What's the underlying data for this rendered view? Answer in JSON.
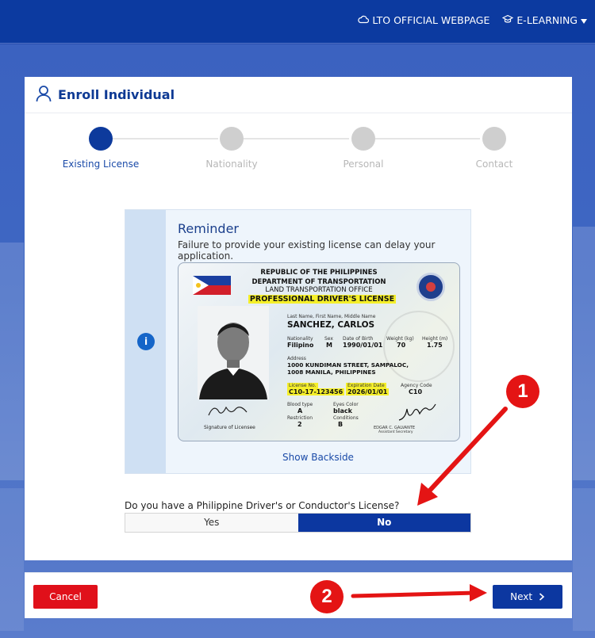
{
  "header": {
    "links": [
      {
        "label": "LTO OFFICIAL WEBPAGE",
        "icon": "cloud-icon"
      },
      {
        "label": "E-LEARNING",
        "icon": "graduation-cap-icon",
        "dropdown": true
      }
    ]
  },
  "card": {
    "title": "Enroll Individual",
    "title_icon": "user-icon"
  },
  "stepper": {
    "steps": [
      {
        "label": "Existing License",
        "active": true
      },
      {
        "label": "Nationality",
        "active": false
      },
      {
        "label": "Personal",
        "active": false
      },
      {
        "label": "Contact",
        "active": false
      }
    ]
  },
  "reminder": {
    "icon": "info-icon",
    "info_glyph": "i",
    "title": "Reminder",
    "text": "Failure to provide your existing license can delay your application.",
    "show_backside": "Show Backside"
  },
  "license_card": {
    "line1": "REPUBLIC OF THE PHILIPPINES",
    "line2": "DEPARTMENT OF TRANSPORTATION",
    "line3": "LAND TRANSPORTATION OFFICE",
    "line4": "PROFESSIONAL DRIVER'S LICENSE",
    "name_label": "Last Name, First Name, Middle Name",
    "name": "SANCHEZ, CARLOS",
    "nationality_label": "Nationality",
    "nationality": "Filipino",
    "sex_label": "Sex",
    "sex": "M",
    "dob_label": "Date of Birth",
    "dob": "1990/01/01",
    "weight_label": "Weight (kg)",
    "weight": "70",
    "height_label": "Height (m)",
    "height": "1.75",
    "address_label": "Address",
    "address_line1": "1000 KUNDIMAN STREET, SAMPALOC,",
    "address_line2": "1008 MANILA, PHILIPPINES",
    "license_no_label": "License No.",
    "license_no": "C10-17-123456",
    "expiration_label": "Expiration Date",
    "expiration": "2026/01/01",
    "agency_label": "Agency Code",
    "agency": "C10",
    "blood_label": "Blood type",
    "blood": "A",
    "eyes_label": "Eyes Color",
    "eyes": "black",
    "restriction_label": "Restriction",
    "restriction": "2",
    "conditions_label": "Conditions",
    "conditions": "B",
    "signature_caption": "Signature of Licensee",
    "official_name": "EDGAR C. GALVANTE",
    "official_title": "Assistant Secretary"
  },
  "question": {
    "text": "Do you have a Philippine Driver's or Conductor's License?",
    "options": [
      {
        "label": "Yes",
        "selected": false
      },
      {
        "label": "No",
        "selected": true
      }
    ]
  },
  "footer": {
    "cancel_label": "Cancel",
    "next_label": "Next",
    "next_icon": "chevron-right-icon"
  },
  "annotations": {
    "badge1": "1",
    "badge2": "2",
    "color": "#e41414"
  },
  "colors": {
    "primary": "#0c37a0",
    "danger": "#e0101a",
    "header_bg": "#0c3aa0",
    "highlight": "#f5ef2a"
  }
}
